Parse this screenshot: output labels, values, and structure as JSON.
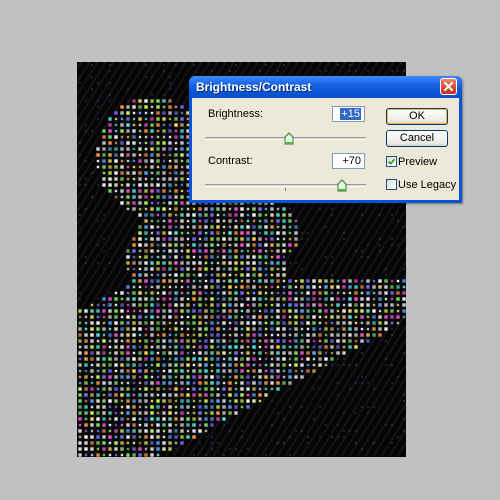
{
  "dialog": {
    "title": "Brightness/Contrast",
    "brightness": {
      "label": "Brightness:",
      "value": "+15",
      "level": 0.52
    },
    "contrast": {
      "label": "Contrast:",
      "value": "+70",
      "level": 0.85
    },
    "ok_label": "OK",
    "cancel_label": "Cancel",
    "preview": {
      "label": "Preview",
      "checked": true
    },
    "use_legacy": {
      "label": "Use Legacy",
      "checked": false
    }
  },
  "icons": {
    "close": "close-icon",
    "slider_thumb": "slider-thumb-icon",
    "checkmark": "checkmark-icon"
  },
  "colors": {
    "title_bar": "#0a55d6",
    "dialog_face": "#ece9d8",
    "selection": "#316ac5",
    "close_button": "#d8452a",
    "workspace": "#c1c1c1",
    "image_background": "#050505"
  }
}
